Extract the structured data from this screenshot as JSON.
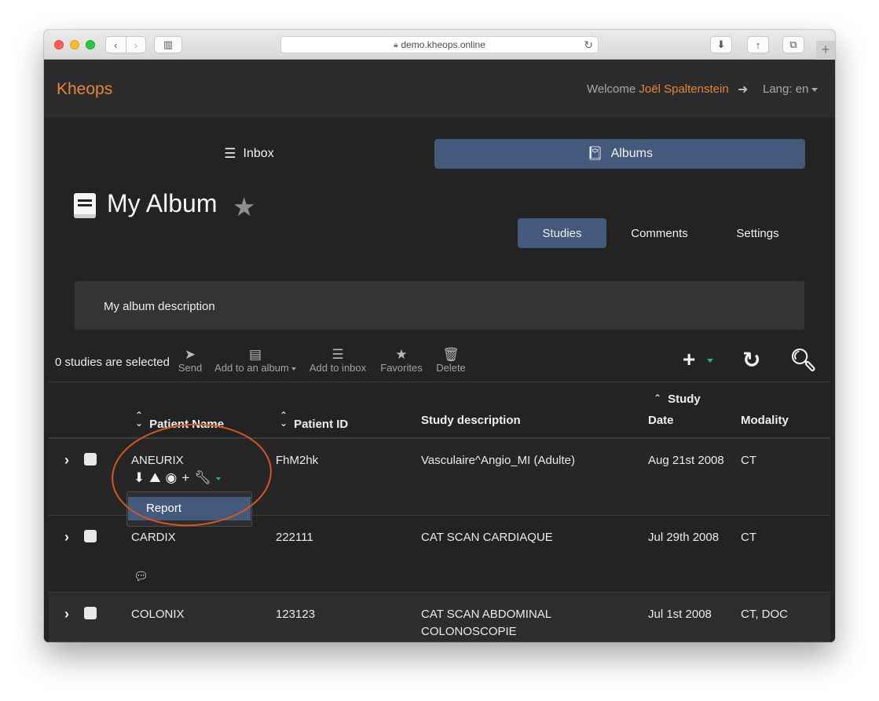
{
  "browser": {
    "url": "demo.kheops.online",
    "icons": {
      "back": "chevron-left-icon",
      "forward": "chevron-right-icon",
      "sidebar": "sidebar-icon",
      "lock": "lock-icon",
      "reload": "reload-icon",
      "download": "download-icon",
      "share": "share-icon",
      "tabs": "tabs-icon",
      "new_tab": "plus-icon"
    }
  },
  "header": {
    "brand": "Kheops",
    "welcome": "Welcome",
    "user": "Joël Spaltenstein",
    "lang": "Lang: en"
  },
  "main_tabs": [
    {
      "label": "Inbox",
      "icon": "list-icon",
      "active": false
    },
    {
      "label": "Albums",
      "icon": "book-icon",
      "active": true
    }
  ],
  "album": {
    "title": "My Album",
    "description": "My album description"
  },
  "sub_tabs": [
    {
      "label": "Studies",
      "active": true
    },
    {
      "label": "Comments",
      "active": false
    },
    {
      "label": "Settings",
      "active": false
    }
  ],
  "actions": {
    "selection_text": "0 studies are selected",
    "send": "Send",
    "add_album": "Add to an album",
    "add_inbox": "Add to inbox",
    "favorites": "Favorites",
    "delete": "Delete"
  },
  "table": {
    "headers": {
      "patient_name": "Patient Name",
      "patient_id": "Patient ID",
      "study_description": "Study description",
      "study_date_1": "Study",
      "study_date_2": "Date",
      "modality": "Modality"
    },
    "rows": [
      {
        "name": "ANEURIX",
        "id": "FhM2hk",
        "description": "Vasculaire^Angio_MI (Adulte)",
        "date": "Aug 21st 2008",
        "modality": "CT"
      },
      {
        "name": "CARDIX",
        "id": "222111",
        "description": "CAT SCAN CARDIAQUE",
        "date": "Jul 29th 2008",
        "modality": "CT"
      },
      {
        "name": "COLONIX",
        "id": "123123",
        "description": "CAT SCAN ABDOMINAL COLONOSCOPIE",
        "date": "Jul 1st 2008",
        "modality": "CT, DOC"
      }
    ],
    "dropdown_item": "Report"
  },
  "colors": {
    "accent": "#e6843d",
    "active_tab": "#435a7d",
    "annotation": "#d9551f",
    "caret_green": "#38b36b"
  }
}
